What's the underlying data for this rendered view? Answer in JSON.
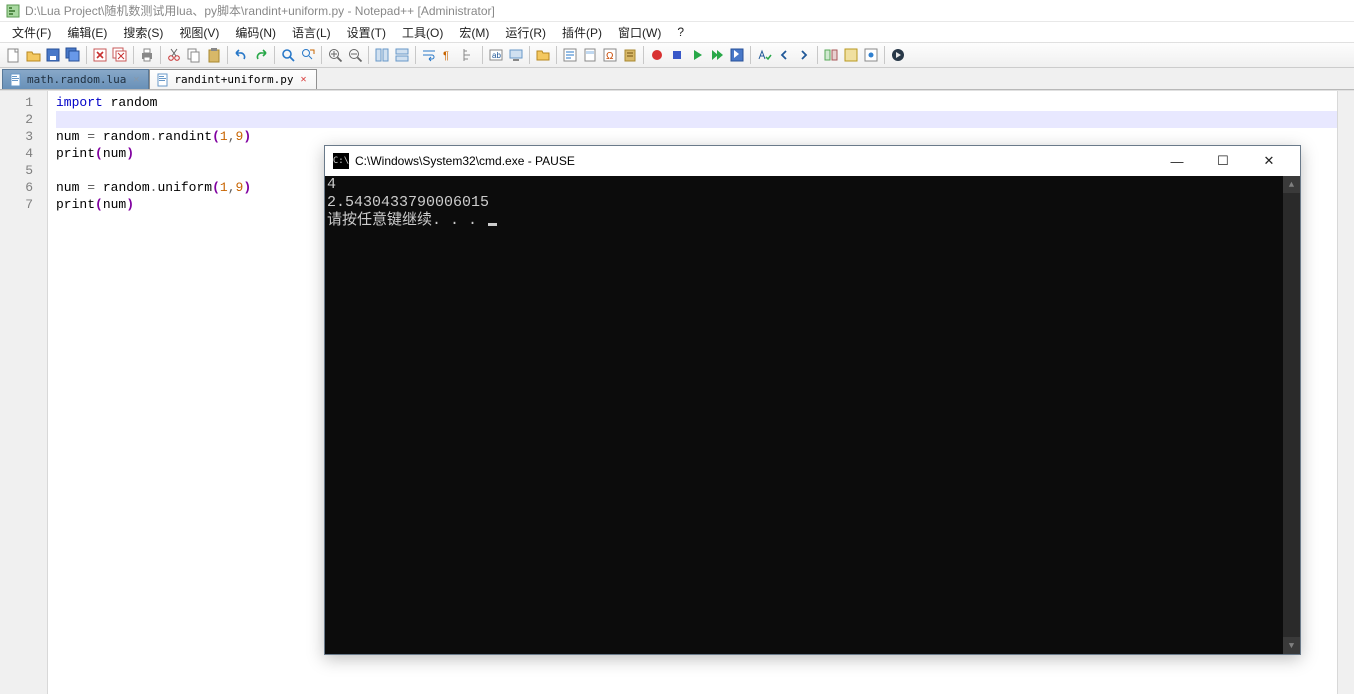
{
  "window": {
    "title": "D:\\Lua Project\\随机数测试用lua、py脚本\\randint+uniform.py - Notepad++ [Administrator]"
  },
  "menu": {
    "items": [
      "文件(F)",
      "编辑(E)",
      "搜索(S)",
      "视图(V)",
      "编码(N)",
      "语言(L)",
      "设置(T)",
      "工具(O)",
      "宏(M)",
      "运行(R)",
      "插件(P)",
      "窗口(W)",
      "?"
    ]
  },
  "toolbar": {
    "groups": [
      [
        "new",
        "open",
        "save",
        "save-all"
      ],
      [
        "close",
        "close-all"
      ],
      [
        "print"
      ],
      [
        "cut",
        "copy",
        "paste"
      ],
      [
        "undo",
        "redo"
      ],
      [
        "find",
        "replace"
      ],
      [
        "zoom-in",
        "zoom-out"
      ],
      [
        "sync-v",
        "sync-h"
      ],
      [
        "wrap",
        "all-chars",
        "indent-guide"
      ],
      [
        "lang",
        "doc-monitor"
      ],
      [
        "folder"
      ],
      [
        "func-list",
        "doc-map",
        "char-panel",
        "clipboard-history"
      ],
      [
        "macro-record",
        "macro-stop",
        "macro-play",
        "macro-play-multi",
        "macro-save"
      ],
      [
        "spell",
        "spell-prev",
        "spell-next"
      ],
      [
        "compare",
        "misc1",
        "bookmark"
      ],
      [
        "run"
      ]
    ]
  },
  "tabs": [
    {
      "label": "math.random.lua",
      "active": false
    },
    {
      "label": "randint+uniform.py",
      "active": true
    }
  ],
  "code": {
    "line_count": 7,
    "tokens": [
      [
        [
          "kw",
          "import"
        ],
        [
          "sp",
          " "
        ],
        [
          "ident",
          "random"
        ]
      ],
      [],
      [
        [
          "ident",
          "num"
        ],
        [
          "sp",
          " "
        ],
        [
          "punct",
          "="
        ],
        [
          "sp",
          " "
        ],
        [
          "ident",
          "random"
        ],
        [
          "punct",
          "."
        ],
        [
          "ident",
          "randint"
        ],
        [
          "paren",
          "("
        ],
        [
          "num",
          "1"
        ],
        [
          "punct",
          ","
        ],
        [
          "num",
          "9"
        ],
        [
          "paren",
          ")"
        ]
      ],
      [
        [
          "builtin",
          "print"
        ],
        [
          "paren",
          "("
        ],
        [
          "ident",
          "num"
        ],
        [
          "paren",
          ")"
        ]
      ],
      [],
      [
        [
          "ident",
          "num"
        ],
        [
          "sp",
          " "
        ],
        [
          "punct",
          "="
        ],
        [
          "sp",
          " "
        ],
        [
          "ident",
          "random"
        ],
        [
          "punct",
          "."
        ],
        [
          "ident",
          "uniform"
        ],
        [
          "paren",
          "("
        ],
        [
          "num",
          "1"
        ],
        [
          "punct",
          ","
        ],
        [
          "num",
          "9"
        ],
        [
          "paren",
          ")"
        ]
      ],
      [
        [
          "builtin",
          "print"
        ],
        [
          "paren",
          "("
        ],
        [
          "ident",
          "num"
        ],
        [
          "paren",
          ")"
        ]
      ]
    ],
    "current_line": 2
  },
  "cmd": {
    "title": "C:\\Windows\\System32\\cmd.exe - PAUSE",
    "lines": [
      "4",
      "2.5430433790006015",
      "请按任意键继续. . . "
    ],
    "controls": {
      "min": "—",
      "max": "☐",
      "close": "✕"
    }
  }
}
